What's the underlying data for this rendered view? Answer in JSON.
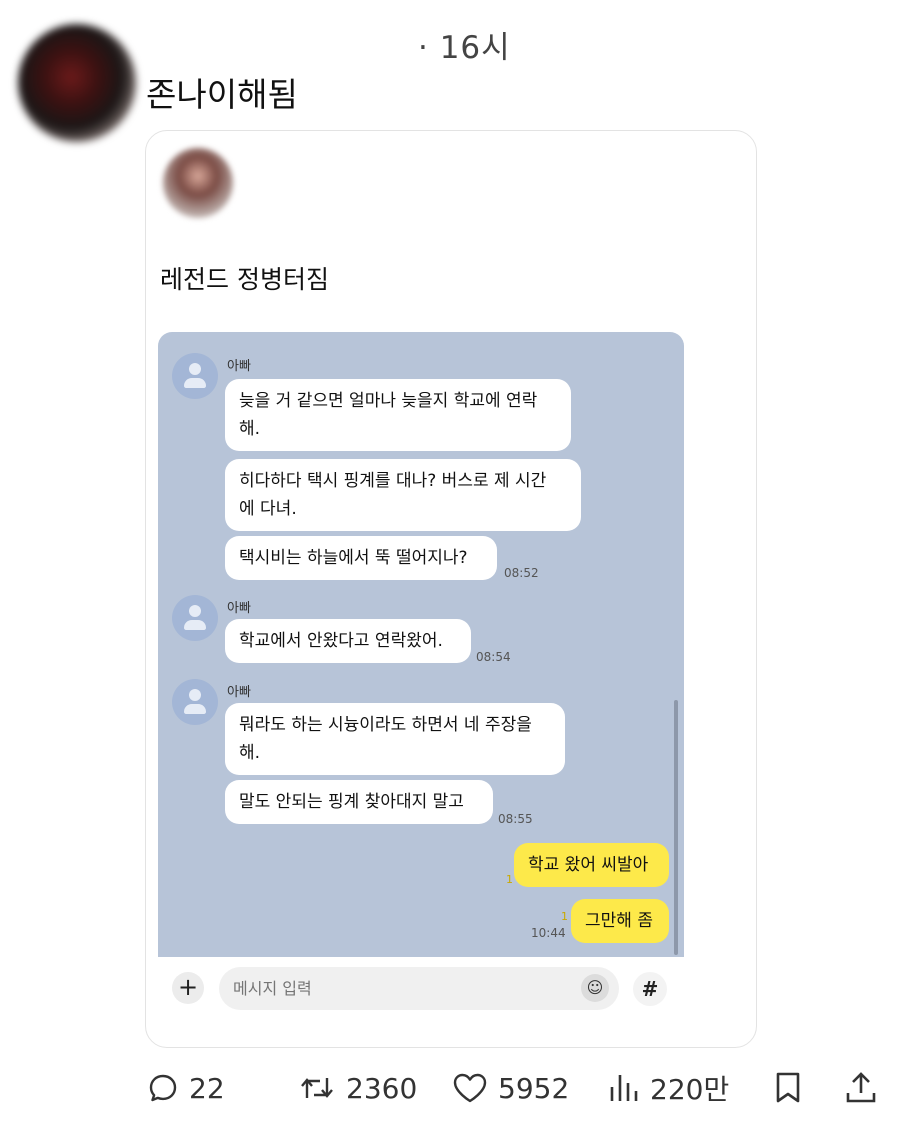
{
  "post": {
    "time": "· 16시",
    "username": "존나이해됨"
  },
  "embedded_post": {
    "title": "레전드 정병터짐"
  },
  "chat": {
    "messages": [
      {
        "sender": "아빠",
        "text": "늦을 거 같으면 얼마나 늦을지 학교에 연락\n해."
      },
      {
        "text": "히다하다 택시 핑계를 대나? 버스로 제 시간\n에 다녀."
      },
      {
        "text": "택시비는 하늘에서 뚝 떨어지나?",
        "time": "08:52"
      },
      {
        "sender": "아빠",
        "text": "학교에서 안왔다고 연락왔어.",
        "time": "08:54"
      },
      {
        "sender": "아빠",
        "text": "뭐라도 하는 시늉이라도 하면서 네 주장을\n해."
      },
      {
        "text": "말도 안되는 핑계 찾아대지 말고",
        "time": "08:55"
      },
      {
        "text": "학교 왔어 씨발아",
        "unread": "1"
      },
      {
        "text": "그만해 좀",
        "unread": "1",
        "time": "10:44"
      }
    ],
    "input_placeholder": "메시지 입력",
    "plus": "+",
    "emoji": "☺",
    "hash": "#"
  },
  "actions": {
    "replies": "22",
    "reposts": "2360",
    "likes": "5952",
    "views": "220만"
  },
  "icons": [
    "reply-icon",
    "repost-icon",
    "heart-icon",
    "views-icon",
    "bookmark-icon",
    "share-icon"
  ]
}
